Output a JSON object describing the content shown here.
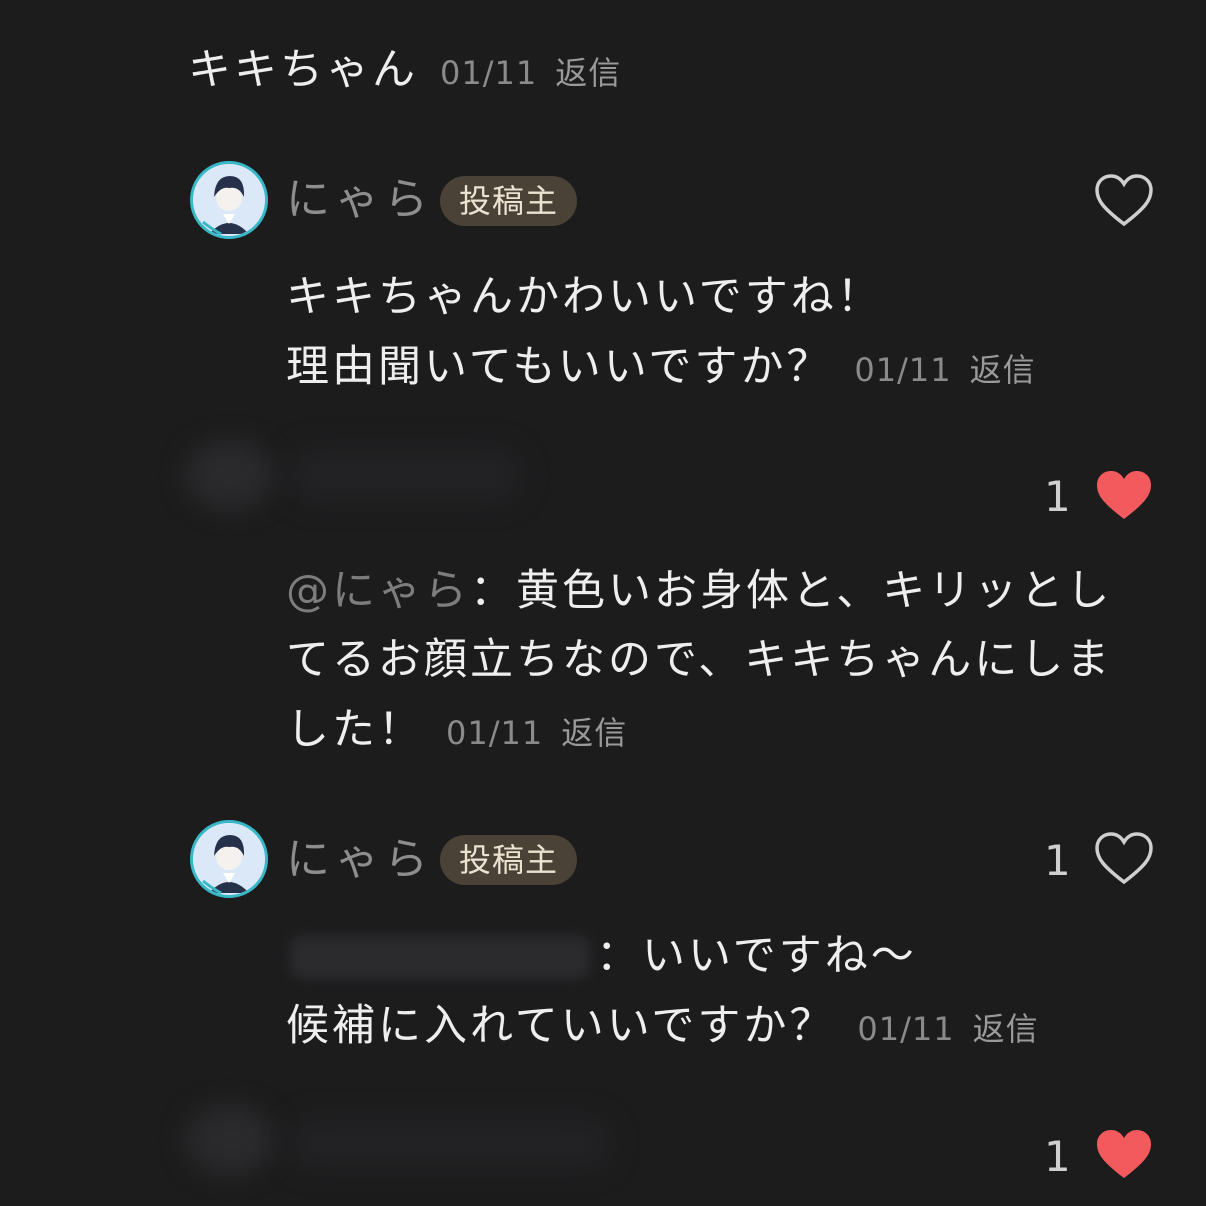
{
  "top_comment": {
    "text": "キキちゃん",
    "date": "01/11",
    "reply": "返信"
  },
  "reply1": {
    "username": "にゃら",
    "badge": "投稿主",
    "line1": "キキちゃんかわいいですね！",
    "line2": "理由聞いてもいいですか？",
    "date": "01/11",
    "reply": "返信",
    "liked": false
  },
  "reply1_likes": {
    "count": "1",
    "liked": true
  },
  "reply2": {
    "mention": "@にゃら",
    "line1_rest": "：黄色いお身体と、キリッとし",
    "line2": "てるお顔立ちなので、キキちゃんにしま",
    "line3": "した！",
    "date": "01/11",
    "reply": "返信"
  },
  "reply3": {
    "username": "にゃら",
    "badge": "投稿主",
    "like_count": "1",
    "liked": false,
    "line1_rest": "：いいですね〜",
    "line2": "候補に入れていいですか？",
    "date": "01/11",
    "reply": "返信"
  },
  "reply3_likes": {
    "count": "1",
    "liked": true
  },
  "colors": {
    "background": "#1c1c1d",
    "heart_active": "#f25a5e",
    "badge_bg": "#4a4236",
    "avatar_ring": "#38b7c6"
  },
  "icons": [
    "heart-outline-icon",
    "heart-filled-icon",
    "avatar"
  ]
}
